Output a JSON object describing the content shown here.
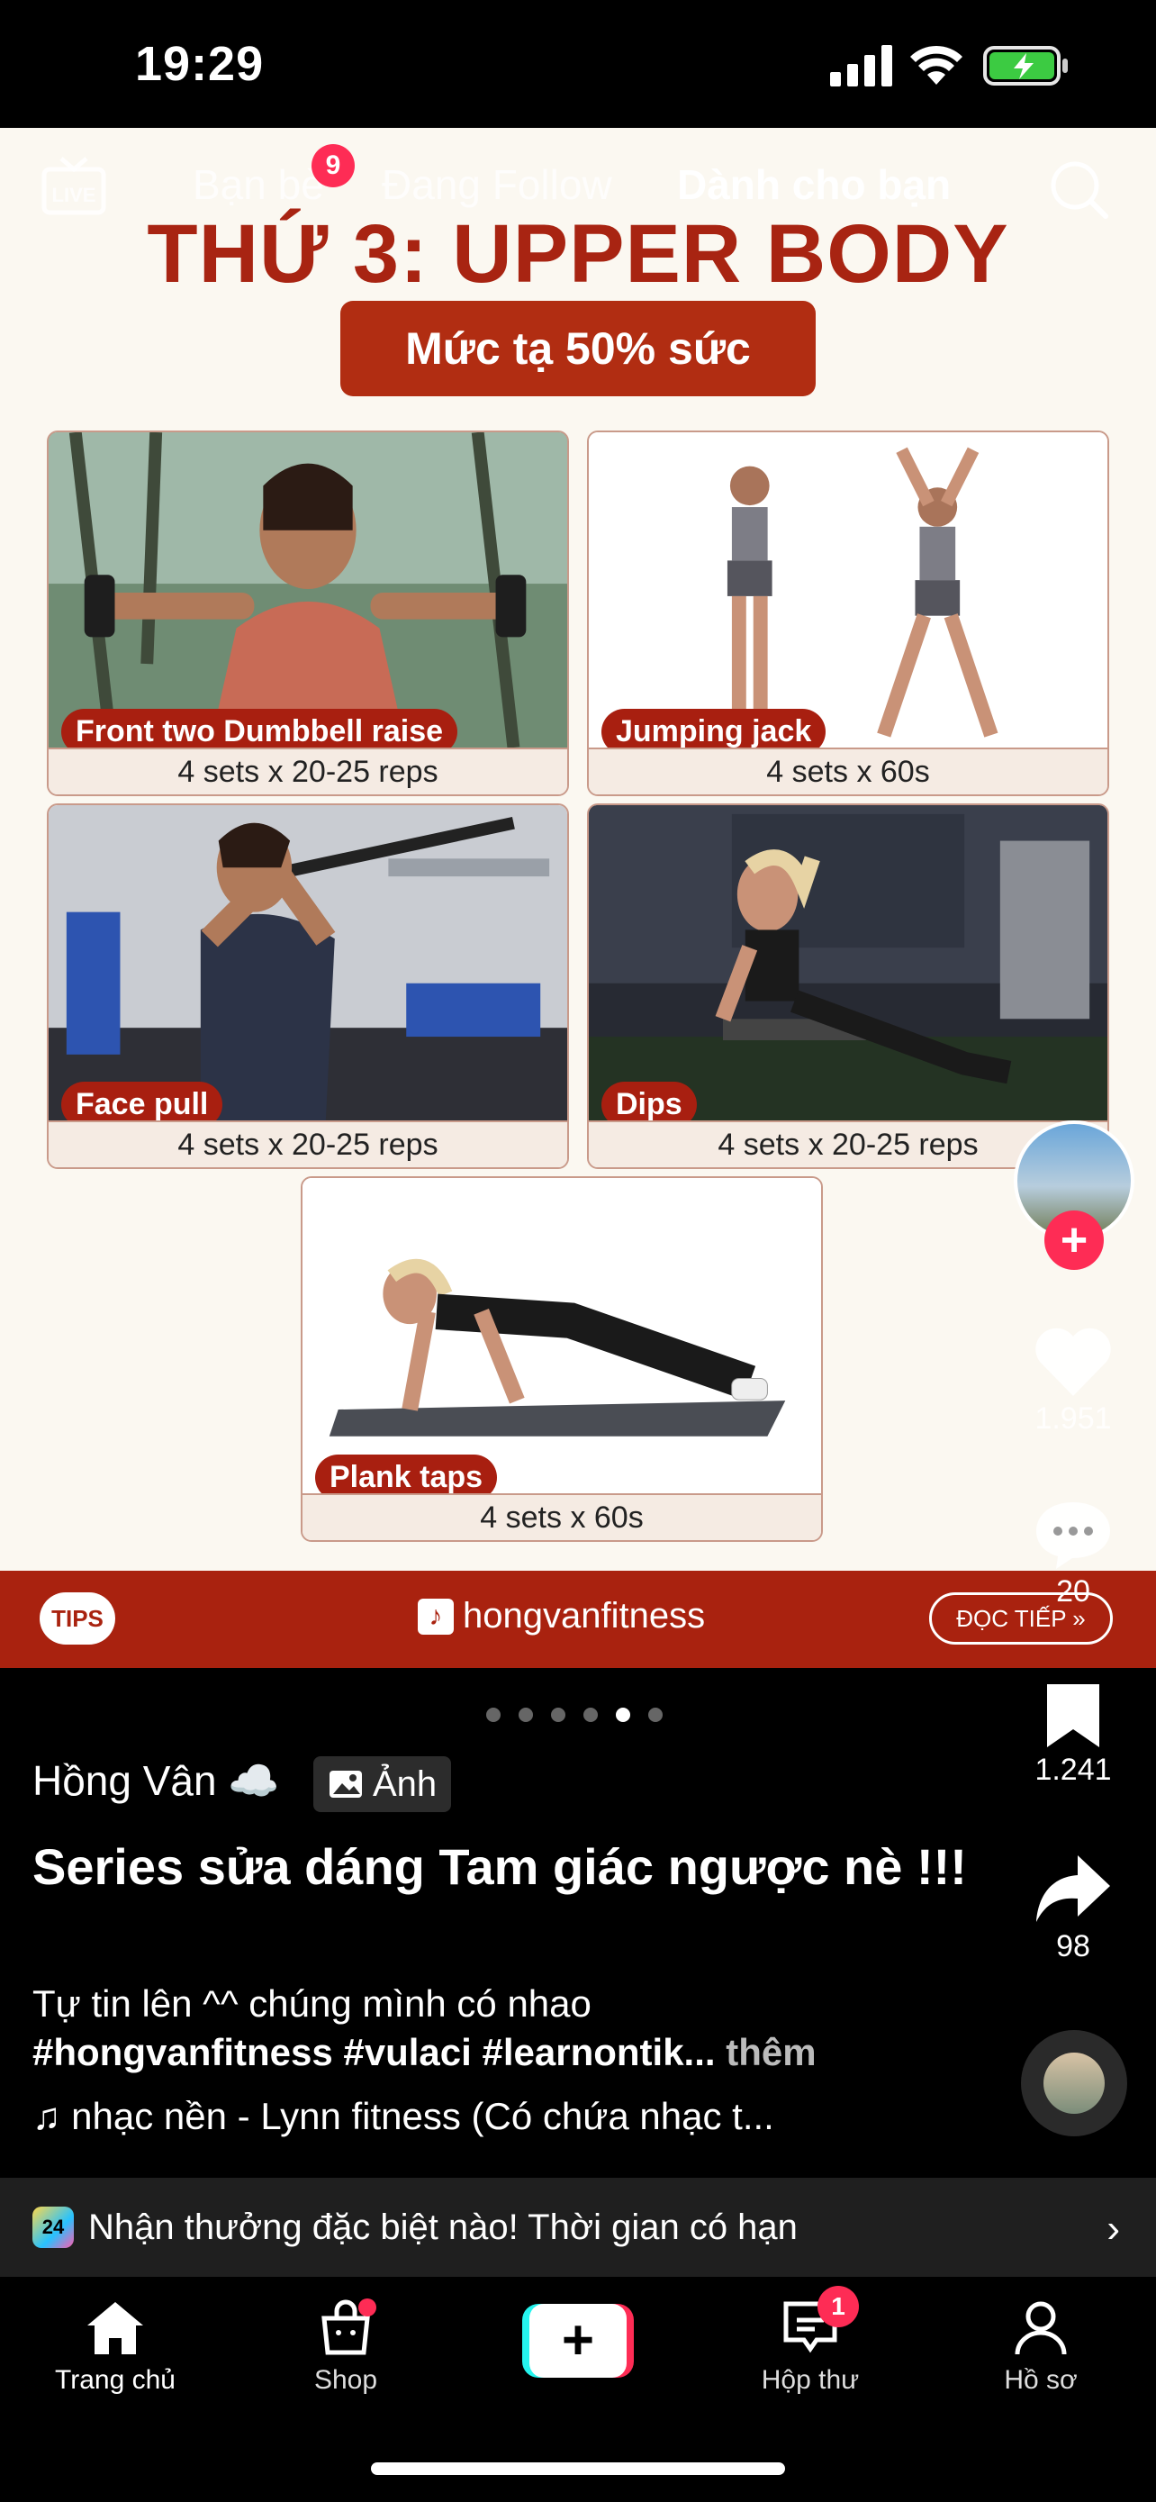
{
  "status_bar": {
    "time": "19:29"
  },
  "top_nav": {
    "live_label": "LIVE",
    "tabs": [
      {
        "label": "Bạn bè",
        "active": false
      },
      {
        "label": "Đang Follow",
        "active": false
      },
      {
        "label": "Dành cho bạn",
        "active": true
      }
    ],
    "friends_badge": "9",
    "search_icon": "search-icon"
  },
  "post": {
    "headline": "THỨ 3: UPPER BODY",
    "subheadline": "Mức tạ 50% sức",
    "exercises": [
      {
        "name": "Front two Dumbbell raise",
        "reps": "4 sets x 20-25 reps"
      },
      {
        "name": "Jumping jack",
        "reps": "4 sets x 60s"
      },
      {
        "name": "Face pull",
        "reps": "4 sets x 20-25 reps"
      },
      {
        "name": "Dips",
        "reps": "4 sets x 20-25 reps"
      },
      {
        "name": "Plank taps",
        "reps": "4 sets x 60s"
      }
    ],
    "footer": {
      "tips": "TIPS",
      "brand": "hongvanfitness",
      "read_more": "ĐỌC TIẾP »"
    }
  },
  "actions": {
    "likes": "1.951",
    "comments": "20",
    "saves": "1.241",
    "shares": "98"
  },
  "carousel": {
    "count": 6,
    "active_index": 4
  },
  "caption": {
    "author": "Hồng Vân ☁️",
    "type_chip": "Ảnh",
    "title": "Series sửa dáng Tam giác ngược nè !!!",
    "desc_text": "Tự tin lên ^^ chúng mình có nhao",
    "hashtags": "#hongvanfitness #vulaci #learnontik...",
    "more": " thêm",
    "music": "♫ nhạc nền - Lynn fitness (Có chứa nhạc t..."
  },
  "promo": {
    "text": "Nhận thưởng đặc biệt nào! Thời gian có hạn",
    "icon": "24"
  },
  "tab_bar": {
    "home": "Trang chủ",
    "shop": "Shop",
    "inbox": "Hộp thư",
    "inbox_badge": "1",
    "profile": "Hồ sơ"
  },
  "colors": {
    "brand_red": "#a9220f",
    "accent_pink": "#fe2c55",
    "cream": "#fbf8f1"
  }
}
